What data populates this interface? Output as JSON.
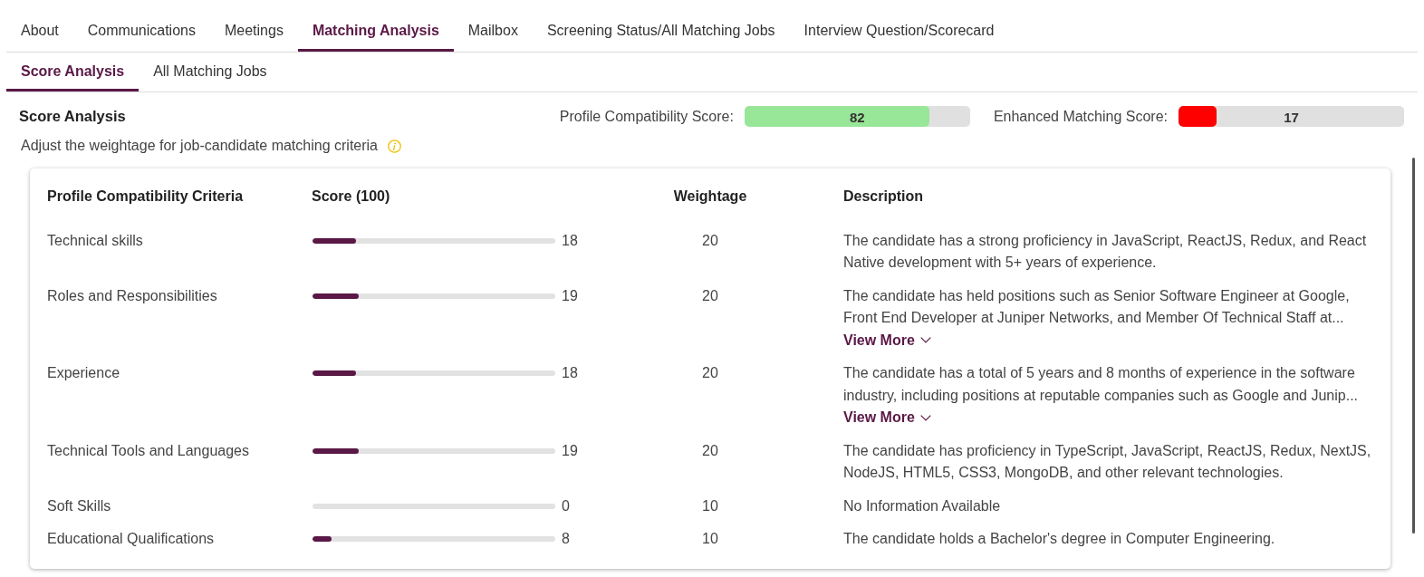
{
  "tabs": [
    {
      "label": "About",
      "selected": false
    },
    {
      "label": "Communications",
      "selected": false
    },
    {
      "label": "Meetings",
      "selected": false
    },
    {
      "label": "Matching Analysis",
      "selected": true
    },
    {
      "label": "Mailbox",
      "selected": false
    },
    {
      "label": "Screening Status/All Matching Jobs",
      "selected": false
    },
    {
      "label": "Interview Question/Scorecard",
      "selected": false
    }
  ],
  "sub_tabs": [
    {
      "label": "Score Analysis",
      "selected": true
    },
    {
      "label": "All Matching Jobs",
      "selected": false
    }
  ],
  "score_analysis": {
    "title": "Score Analysis",
    "scores": [
      {
        "label": "Profile Compatibility Score:",
        "value": "82",
        "level": 0.82,
        "color": "#98e698"
      },
      {
        "label": "Enhanced Matching Score:",
        "value": "17",
        "level": 0.17,
        "color": "#ff0000"
      }
    ],
    "subtitle": "Adjust the weightage for job-candidate matching criteria"
  },
  "table": {
    "columns": [
      "Profile Compatibility Criteria",
      "Score (100)",
      "Weightage",
      "Description"
    ],
    "rows": [
      {
        "criteria": "Technical skills",
        "score": "18",
        "level": 0.18,
        "weightage": "20",
        "description": "The candidate has a strong proficiency in JavaScript, ReactJS, Redux, and React Native development with 5+ years of experience."
      },
      {
        "criteria": "Roles and Responsibilities",
        "score": "19",
        "level": 0.19,
        "weightage": "20",
        "description": "The candidate has held positions such as Senior Software Engineer at Google, Front End Developer at Juniper Networks, and Member Of Technical Staff at...",
        "view_more": "View More"
      },
      {
        "criteria": "Experience",
        "score": "18",
        "level": 0.18,
        "weightage": "20",
        "description": "The candidate has a total of 5 years and 8 months of experience in the software industry, including positions at reputable companies such as Google and Junip...",
        "view_more": "View More"
      },
      {
        "criteria": "Technical Tools and Languages",
        "score": "19",
        "level": 0.19,
        "weightage": "20",
        "description": "The candidate has proficiency in TypeScript, JavaScript, ReactJS, Redux, NextJS, NodeJS, HTML5, CSS3, MongoDB, and other relevant technologies."
      },
      {
        "criteria": "Soft Skills",
        "score": "0",
        "level": 0,
        "weightage": "10",
        "description": "No Information Available"
      },
      {
        "criteria": "Educational Qualifications",
        "score": "8",
        "level": 0.08,
        "weightage": "10",
        "description": "The candidate holds a Bachelor's degree in Computer Engineering."
      }
    ]
  }
}
